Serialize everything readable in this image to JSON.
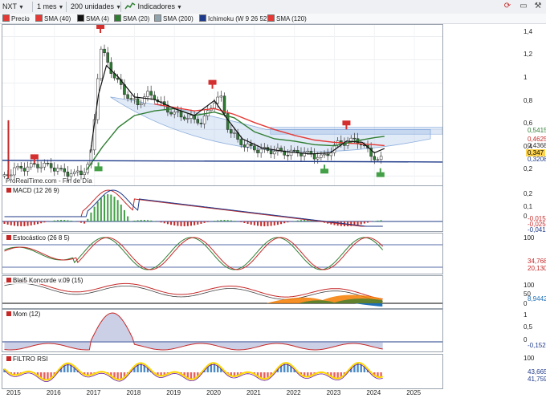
{
  "toolbar": {
    "symbol": "NXT",
    "period": "1 mes",
    "units": "200 unidades",
    "indicators": "Indicadores"
  },
  "legend": {
    "price": "Precio",
    "items": [
      {
        "label": "SMA (40)",
        "color": "#e53935"
      },
      {
        "label": "SMA (4)",
        "color": "#111111"
      },
      {
        "label": "SMA (20)",
        "color": "#2e7d32"
      },
      {
        "label": "SMA (200)",
        "color": "#90a4ae"
      },
      {
        "label": "Ichimoku (W 9 26 52)",
        "color": "#1e3a8a"
      },
      {
        "label": "SMA (120)",
        "color": "#e53935"
      }
    ]
  },
  "watermark": "ProRealTime.com - Fin de Día",
  "price_axis": {
    "ticks": [
      "1,4",
      "1,2",
      "1",
      "0,8",
      "0,6",
      "0,4",
      "0,2"
    ],
    "tags": [
      {
        "text": "0,5415",
        "bg": "#ffffff",
        "fg": "#2e7d32"
      },
      {
        "text": "0,4625",
        "bg": "#ffffff",
        "fg": "#c62828"
      },
      {
        "text": "0,4368",
        "bg": "#ffffff",
        "fg": "#333333"
      },
      {
        "text": "0,347",
        "bg": "#ffd54f",
        "fg": "#000000"
      },
      {
        "text": "0,3208",
        "bg": "#ffffff",
        "fg": "#1e3a8a"
      }
    ]
  },
  "macd": {
    "label": "MACD (12 26 9)",
    "ticks": [
      "0,2",
      "0,1",
      "0"
    ],
    "tags": [
      "-0,0156",
      "-0,0258",
      "-0,0416"
    ]
  },
  "stoch": {
    "label": "Estocástico (26 8 5)",
    "ticks": [
      "100"
    ],
    "tags": [
      "34,768",
      "20,130"
    ]
  },
  "blai5": {
    "label": "Blai5 Koncorde v.09 (15)",
    "ticks": [
      "100",
      "50",
      "0"
    ],
    "tags": [
      "8,9442"
    ]
  },
  "mom": {
    "label": "Mom (12)",
    "ticks": [
      "1",
      "0,5",
      "0"
    ],
    "tags": [
      "-0,1520"
    ]
  },
  "rsi": {
    "label": "FILTRO RSI",
    "ticks": [
      "100"
    ],
    "tags": [
      "43,665",
      "41,759"
    ]
  },
  "xaxis": [
    "2015",
    "2016",
    "2017",
    "2018",
    "2019",
    "2020",
    "2021",
    "2022",
    "2023",
    "2024",
    "2025"
  ],
  "chart_data": {
    "type": "line",
    "title": "NXT",
    "x_range": [
      2014.7,
      2025.7
    ],
    "ylim": [
      0.12,
      1.5
    ],
    "price": {
      "x": [
        2014.75,
        2015.0,
        2015.3,
        2015.6,
        2015.9,
        2016.2,
        2016.5,
        2016.75,
        2016.85,
        2016.95,
        2017.05,
        2017.15,
        2017.3,
        2017.5,
        2017.7,
        2017.9,
        2018.1,
        2018.3,
        2018.5,
        2018.7,
        2018.9,
        2019.1,
        2019.3,
        2019.5,
        2019.7,
        2019.85,
        2020.0,
        2020.15,
        2020.35,
        2020.6,
        2020.9,
        2021.2,
        2021.5,
        2021.8,
        2022.1,
        2022.4,
        2022.7,
        2022.9,
        2023.1,
        2023.35,
        2023.55,
        2023.75,
        2023.95,
        2024.1,
        2024.2
      ],
      "y": [
        0.2,
        0.26,
        0.28,
        0.3,
        0.29,
        0.24,
        0.22,
        0.25,
        0.3,
        0.45,
        0.95,
        1.3,
        1.2,
        1.05,
        0.95,
        0.85,
        0.82,
        0.9,
        0.88,
        0.8,
        0.75,
        0.72,
        0.7,
        0.68,
        0.66,
        0.75,
        0.85,
        0.88,
        0.6,
        0.5,
        0.44,
        0.42,
        0.42,
        0.4,
        0.41,
        0.39,
        0.36,
        0.42,
        0.49,
        0.5,
        0.52,
        0.45,
        0.38,
        0.33,
        0.35
      ]
    },
    "series": [
      {
        "name": "SMA (40)",
        "color": "#e53935",
        "x": [
          2018.5,
          2019.0,
          2019.5,
          2020.0,
          2020.5,
          2021.0,
          2021.5,
          2022.0,
          2022.5,
          2023.0,
          2023.5,
          2024.0,
          2024.25
        ],
        "y": [
          0.82,
          0.79,
          0.76,
          0.78,
          0.73,
          0.66,
          0.6,
          0.55,
          0.51,
          0.49,
          0.48,
          0.47,
          0.4625
        ]
      },
      {
        "name": "SMA (20)",
        "color": "#2e7d32",
        "x": [
          2016.8,
          2017.2,
          2017.6,
          2018.0,
          2018.5,
          2019.0,
          2019.5,
          2020.0,
          2020.5,
          2021.0,
          2021.5,
          2022.0,
          2022.5,
          2023.0,
          2023.5,
          2024.0,
          2024.25
        ],
        "y": [
          0.25,
          0.45,
          0.62,
          0.72,
          0.76,
          0.78,
          0.72,
          0.75,
          0.7,
          0.58,
          0.52,
          0.5,
          0.47,
          0.46,
          0.5,
          0.53,
          0.5415
        ]
      },
      {
        "name": "SMA (4)",
        "color": "#111111",
        "x": [
          2016.9,
          2017.1,
          2017.3,
          2017.6,
          2018.0,
          2018.5,
          2019.0,
          2019.5,
          2020.0,
          2020.3,
          2020.7,
          2021.2,
          2021.8,
          2022.4,
          2022.9,
          2023.3,
          2023.7,
          2024.0,
          2024.25
        ],
        "y": [
          0.4,
          0.9,
          1.15,
          1.05,
          0.88,
          0.86,
          0.78,
          0.72,
          0.85,
          0.7,
          0.52,
          0.44,
          0.41,
          0.39,
          0.4,
          0.5,
          0.49,
          0.4,
          0.4368
        ]
      },
      {
        "name": "SMA (120)",
        "color": "#1e3a8a",
        "x": [
          2014.7,
          2025.7
        ],
        "y": [
          0.335,
          0.3208
        ]
      }
    ],
    "markers": {
      "sell": [
        [
          2015.5,
          0.38
        ],
        [
          2017.15,
          1.5
        ],
        [
          2019.95,
          1.02
        ],
        [
          2023.3,
          0.67
        ]
      ],
      "buy": [
        [
          2017.1,
          0.29
        ],
        [
          2022.75,
          0.27
        ],
        [
          2024.15,
          0.24
        ]
      ]
    }
  }
}
